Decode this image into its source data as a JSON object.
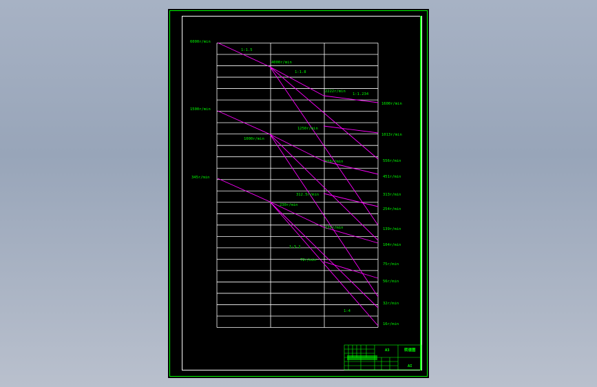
{
  "drawing": {
    "speed_labels_left": [
      "6000r/min",
      "1500r/min",
      "345r/min"
    ],
    "speed_labels_inner": [
      "4000r/min",
      "2222r/min",
      "1250r/min",
      "1000r/min",
      "556r/min",
      "312.5r/min",
      "230r/min",
      "125r/min",
      "72r/min"
    ],
    "speed_labels_right": [
      "1600r/min",
      "1013r/min",
      "556r/min",
      "451r/min",
      "313r/min",
      "254r/min",
      "139r/min",
      "104r/min",
      "75r/min",
      "56r/min",
      "32r/min",
      "16r/min"
    ],
    "ratio_labels": [
      "1:1.5",
      "1:1.8",
      "1:1.234",
      "1:3.2",
      "1:4"
    ]
  },
  "title_block": {
    "name": "转速图",
    "number": "A3",
    "sheet": "AI"
  },
  "colors": {
    "background": "#000000",
    "frame": "#00ff00",
    "grid": "#ffffff",
    "speed_lines": "#ff00ff",
    "labels": "#00ff00",
    "title_block": "#00ff00"
  }
}
